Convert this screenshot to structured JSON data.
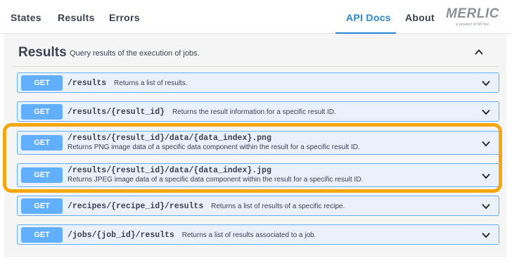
{
  "nav": {
    "items": [
      {
        "label": "States"
      },
      {
        "label": "Results"
      },
      {
        "label": "Errors"
      },
      {
        "label": "API Docs"
      },
      {
        "label": "About"
      }
    ],
    "brand": {
      "name": "MERLIC",
      "subtitle": "a product of MVTec"
    }
  },
  "section": {
    "title": "Results",
    "description": "Query results of the execution of jobs.",
    "toggle_icon": "chevron-up-icon"
  },
  "operations": [
    {
      "method": "GET",
      "path": "/results",
      "summary": "Returns a list of results."
    },
    {
      "method": "GET",
      "path": "/results/{result_id}",
      "summary": "Returns the result information for a specific result ID."
    },
    {
      "method": "GET",
      "path": "/results/{result_id}/data/{data_index}.png",
      "summary": "Returns PNG image data of a specific data component within the result for a specific result ID."
    },
    {
      "method": "GET",
      "path": "/results/{result_id}/data/{data_index}.jpg",
      "summary": "Returns JPEG image data of a specific data component within the result for a specific result ID."
    },
    {
      "method": "GET",
      "path": "/recipes/{recipe_id}/results",
      "summary": "Returns a list of results of a specific recipe."
    },
    {
      "method": "GET",
      "path": "/jobs/{job_id}/results",
      "summary": "Returns a list of results associated to a job."
    }
  ],
  "colors": {
    "get_method": "#61affe",
    "get_background": "#e9f1fa",
    "active_nav": "#2b87d1",
    "highlight": "#f4a70e"
  }
}
